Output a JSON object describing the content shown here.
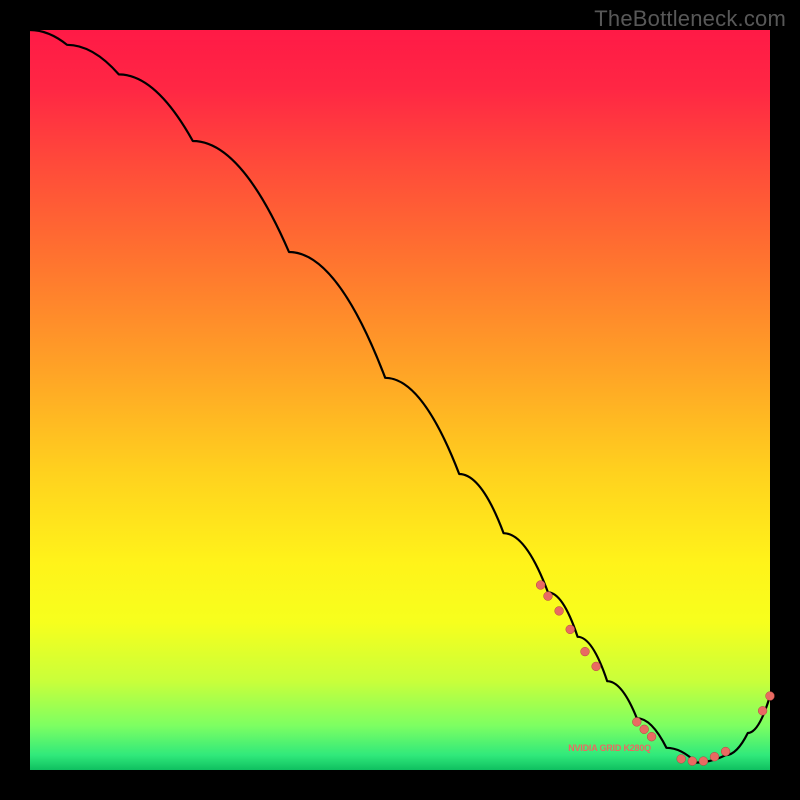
{
  "watermark": "TheBottleneck.com",
  "chart_data": {
    "type": "line",
    "title": "",
    "xlabel": "",
    "ylabel": "",
    "xlim": [
      0,
      100
    ],
    "ylim": [
      0,
      100
    ],
    "series": [
      {
        "name": "bottleneck-curve",
        "x": [
          0,
          5,
          12,
          22,
          35,
          48,
          58,
          64,
          70,
          74,
          78,
          82,
          86,
          90,
          94,
          97,
          100
        ],
        "y": [
          100,
          98,
          94,
          85,
          70,
          53,
          40,
          32,
          24,
          18,
          12,
          7,
          3,
          1,
          2,
          5,
          10
        ]
      }
    ],
    "markers": {
      "name": "highlight-dots",
      "points": [
        {
          "x": 69,
          "y": 25
        },
        {
          "x": 70,
          "y": 23.5
        },
        {
          "x": 71.5,
          "y": 21.5
        },
        {
          "x": 73,
          "y": 19
        },
        {
          "x": 75,
          "y": 16
        },
        {
          "x": 76.5,
          "y": 14
        },
        {
          "x": 82,
          "y": 6.5
        },
        {
          "x": 83,
          "y": 5.5
        },
        {
          "x": 84,
          "y": 4.5
        },
        {
          "x": 88,
          "y": 1.5
        },
        {
          "x": 89.5,
          "y": 1.2
        },
        {
          "x": 91,
          "y": 1.2
        },
        {
          "x": 92.5,
          "y": 1.8
        },
        {
          "x": 94,
          "y": 2.5
        },
        {
          "x": 99,
          "y": 8
        },
        {
          "x": 100,
          "y": 10
        }
      ]
    },
    "optimal_label": {
      "text": "NVIDIA GRID K280Q",
      "x": 84,
      "y": 3
    },
    "colors": {
      "curve": "#000000",
      "dots": "#e96a62",
      "gradient_top": "#ff1a46",
      "gradient_mid": "#ffd21e",
      "gradient_bottom": "#0fbf60"
    }
  }
}
